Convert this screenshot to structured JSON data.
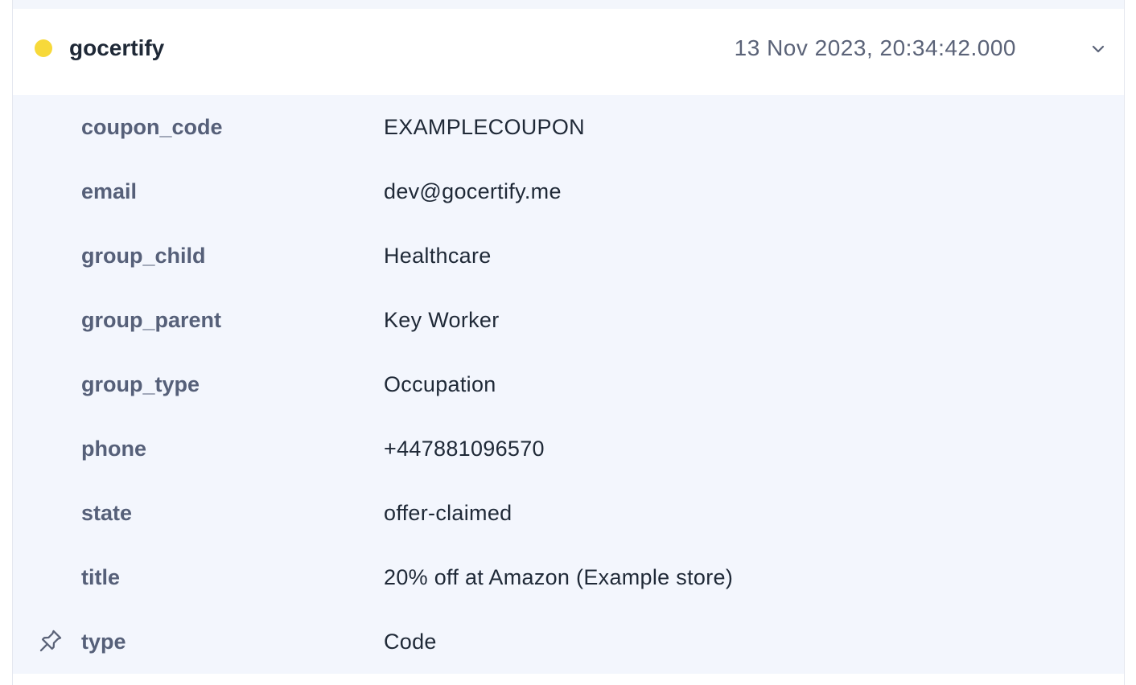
{
  "event": {
    "source": "gocertify",
    "timestamp": "13 Nov 2023, 20:34:42.000",
    "status_color": "#f7d93a",
    "expand_icon": "chevron-down-icon"
  },
  "properties": [
    {
      "key": "coupon_code",
      "value": "EXAMPLECOUPON"
    },
    {
      "key": "email",
      "value": "dev@gocertify.me"
    },
    {
      "key": "group_child",
      "value": "Healthcare"
    },
    {
      "key": "group_parent",
      "value": "Key Worker"
    },
    {
      "key": "group_type",
      "value": "Occupation"
    },
    {
      "key": "phone",
      "value": "+447881096570"
    },
    {
      "key": "state",
      "value": "offer-claimed"
    },
    {
      "key": "title",
      "value": "20% off at Amazon (Example store)"
    },
    {
      "key": "type",
      "value": "Code",
      "pinned": true,
      "pin_icon": "pin-icon"
    }
  ]
}
